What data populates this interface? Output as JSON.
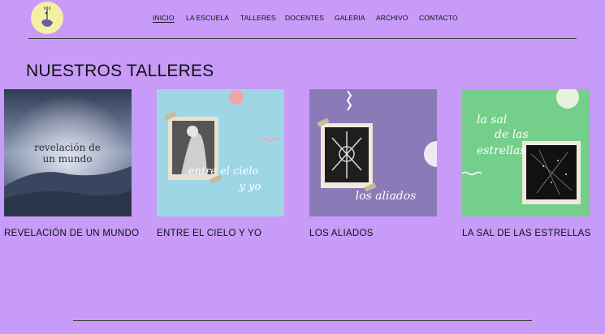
{
  "nav": {
    "items": [
      "INICIO",
      "LA ESCUELA",
      "TALLERES",
      "DOCENTES",
      "GALERIA",
      "ARCHIVO",
      "CONTACTO"
    ],
    "active": "INICIO"
  },
  "section": {
    "title": "NUESTROS TALLERES"
  },
  "workshops": [
    {
      "title": "REVELACIÓN DE UN MUNDO",
      "image_text": [
        "revelación de",
        "un mundo"
      ]
    },
    {
      "title": "ENTRE EL CIELO Y YO",
      "image_text": [
        "entre el cielo",
        "y yo"
      ]
    },
    {
      "title": "LOS ALIADOS",
      "image_text": [
        "los aliados"
      ]
    },
    {
      "title": "LA SAL DE LAS ESTRELLAS",
      "image_text": [
        "la sal",
        "de las",
        "estrellas"
      ]
    }
  ],
  "colors": {
    "background": "#c79bf7",
    "logo_bg": "#f3f0a6",
    "card1": "#5a6a8a",
    "card2": "#9fd6e6",
    "card3": "#8a7bb8",
    "card4": "#74cf8a"
  }
}
